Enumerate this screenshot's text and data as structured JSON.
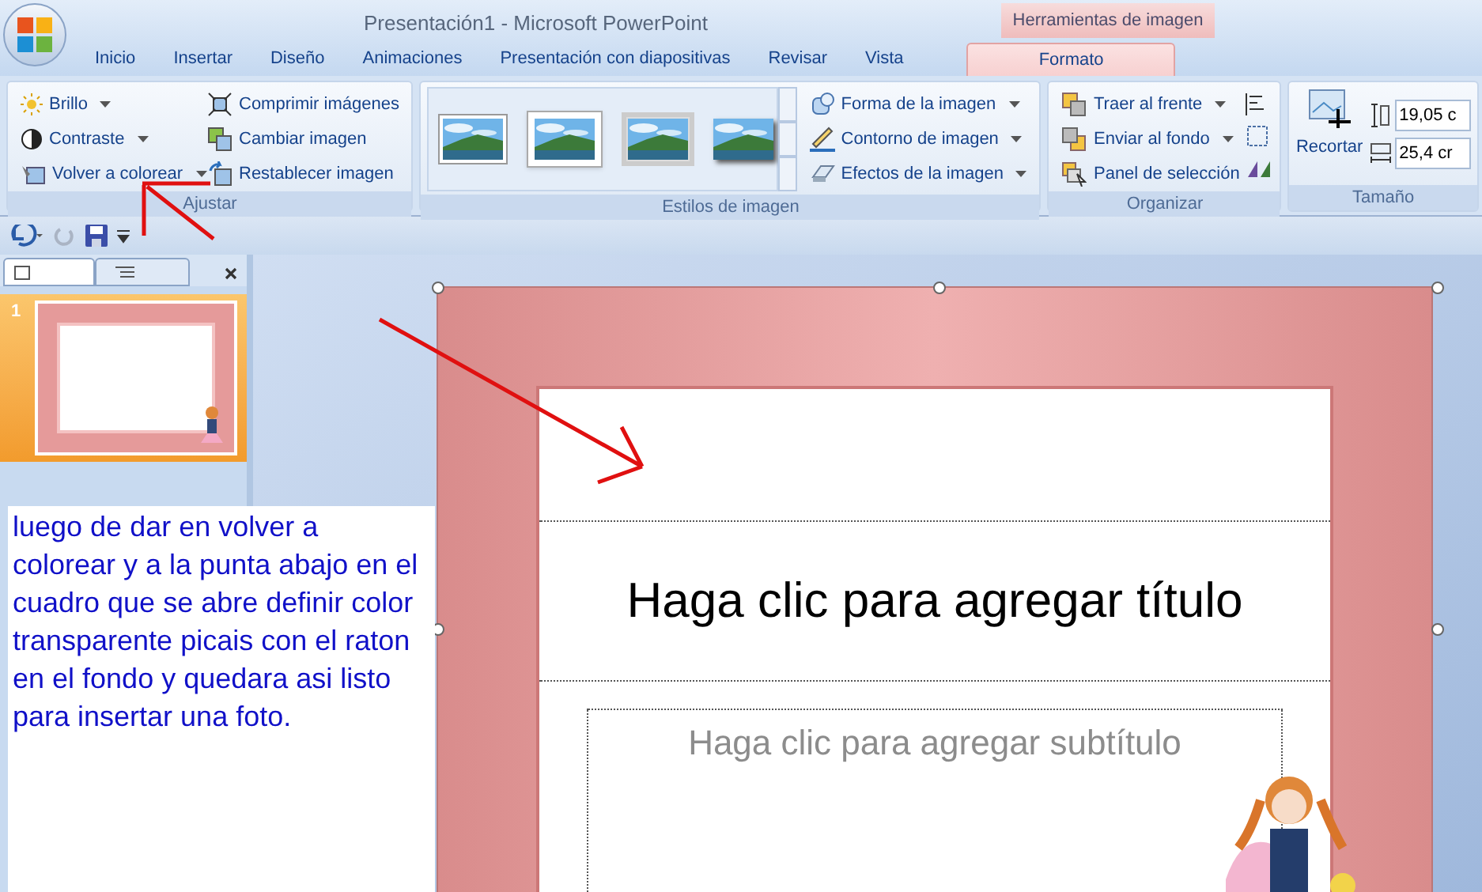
{
  "window": {
    "title": "Presentación1 - Microsoft PowerPoint"
  },
  "contextual_group": {
    "label": "Herramientas de imagen"
  },
  "tabs": [
    {
      "label": "Inicio",
      "selected": false
    },
    {
      "label": "Insertar",
      "selected": false
    },
    {
      "label": "Diseño",
      "selected": false
    },
    {
      "label": "Animaciones",
      "selected": false
    },
    {
      "label": "Presentación con diapositivas",
      "selected": false
    },
    {
      "label": "Revisar",
      "selected": false
    },
    {
      "label": "Vista",
      "selected": false
    },
    {
      "label": "Formato",
      "selected": true
    }
  ],
  "ribbon": {
    "ajustar": {
      "label": "Ajustar",
      "commands": [
        {
          "label": "Brillo",
          "dropdown": true
        },
        {
          "label": "Contraste",
          "dropdown": true
        },
        {
          "label": "Volver a colorear",
          "dropdown": true
        },
        {
          "label": "Comprimir imágenes",
          "dropdown": false
        },
        {
          "label": "Cambiar imagen",
          "dropdown": false
        },
        {
          "label": "Restablecer imagen",
          "dropdown": false
        }
      ]
    },
    "estilos": {
      "label": "Estilos de imagen",
      "styles": [
        {
          "selected": false
        },
        {
          "selected": false
        },
        {
          "selected": false
        },
        {
          "selected": false
        }
      ],
      "commands": [
        {
          "label": "Forma de la imagen",
          "dropdown": true
        },
        {
          "label": "Contorno de imagen",
          "dropdown": true
        },
        {
          "label": "Efectos de la imagen",
          "dropdown": true
        }
      ]
    },
    "organizar": {
      "label": "Organizar",
      "commands": [
        {
          "label": "Traer al frente",
          "dropdown": true
        },
        {
          "label": "Enviar al fondo",
          "dropdown": true
        },
        {
          "label": "Panel de selección",
          "dropdown": false
        }
      ]
    },
    "tamano": {
      "label": "Tamaño",
      "crop": "Recortar",
      "height": "19,05 c",
      "width": "25,4 cr"
    }
  },
  "slides_panel": {
    "thumbnails": [
      {
        "number": "1",
        "selected": true
      }
    ]
  },
  "note": "luego de dar en volver a colorear y a la punta abajo en el cuadro que se abre definir color transparente picais con el raton en el fondo y quedara asi listo para insertar una foto.",
  "slide": {
    "title_placeholder": "Haga clic para agregar título",
    "subtitle_placeholder": "Haga clic para agregar subtítulo"
  }
}
